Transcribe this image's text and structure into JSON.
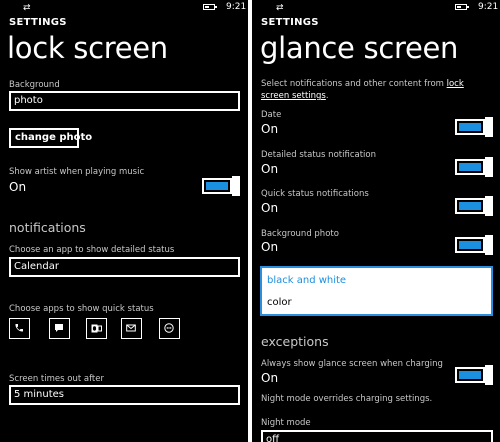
{
  "status_bar": {
    "time": "9:21"
  },
  "left": {
    "header": "SETTINGS",
    "title": "lock screen",
    "background_label": "Background",
    "background_value": "photo",
    "change_photo_button": "change photo",
    "show_artist_label": "Show artist when playing music",
    "show_artist_value": "On",
    "notifications_heading": "notifications",
    "detailed_status_label": "Choose an app to show detailed status",
    "detailed_status_value": "Calendar",
    "quick_status_label": "Choose apps to show quick status",
    "quick_status_apps": [
      "phone",
      "message",
      "outlook",
      "mail",
      "chat"
    ],
    "timeout_label": "Screen times out after",
    "timeout_value": "5 minutes"
  },
  "right": {
    "header": "SETTINGS",
    "title": "glance screen",
    "description": "Select notifications and other content from ",
    "description_link": "lock screen settings",
    "description_end": ".",
    "date_label": "Date",
    "date_value": "On",
    "detailed_label": "Detailed status notification",
    "detailed_value": "On",
    "quick_label": "Quick status notifications",
    "quick_value": "On",
    "bgphoto_label": "Background photo",
    "bgphoto_value": "On",
    "picker_options": [
      "black and white",
      "color"
    ],
    "exceptions_heading": "exceptions",
    "charging_label": "Always show glance screen when charging",
    "charging_value": "On",
    "night_note": "Night mode overrides charging settings.",
    "night_label": "Night mode",
    "night_value": "off"
  },
  "colors": {
    "accent": "#1b8fe0",
    "background": "#000000",
    "foreground": "#ffffff"
  }
}
